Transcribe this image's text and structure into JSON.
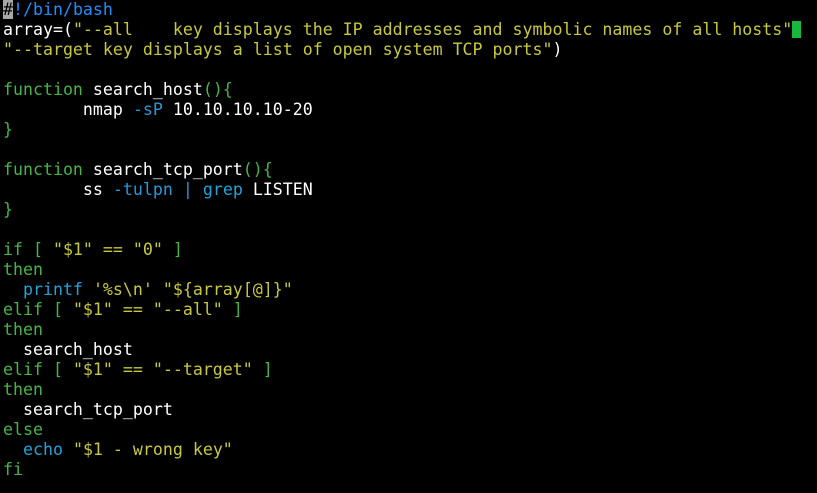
{
  "editor": {
    "language": "bash",
    "colors": {
      "background": "#000000",
      "plain": "#ffffff",
      "comment": "#1e8fff",
      "keyword": "#46b446",
      "string": "#c8c83c",
      "operator": "#2b96d6",
      "command": "#1fa3d9",
      "cursor": "#18b83c"
    },
    "lines": [
      [
        {
          "t": "#",
          "c": "first"
        },
        {
          "t": "!/bin/bash",
          "c": "comment"
        }
      ],
      [
        {
          "t": "array=(",
          "c": "plain"
        },
        {
          "t": "\"--all    key displays the IP addresses and symbolic names of all hosts\"",
          "c": "str"
        },
        {
          "cursor": true
        }
      ],
      [
        {
          "t": "\"--target key displays a list of open system TCP ports\"",
          "c": "str"
        },
        {
          "t": ")",
          "c": "plain"
        }
      ],
      [],
      [
        {
          "t": "function",
          "c": "kw"
        },
        {
          "t": " search_host",
          "c": "plain"
        },
        {
          "t": "(){",
          "c": "kw"
        }
      ],
      [
        {
          "t": "        nmap ",
          "c": "plain"
        },
        {
          "t": "-sP",
          "c": "op"
        },
        {
          "t": " 10.10.10.10-20",
          "c": "plain"
        }
      ],
      [
        {
          "t": "}",
          "c": "kw"
        }
      ],
      [],
      [
        {
          "t": "function",
          "c": "kw"
        },
        {
          "t": " search_tcp_port",
          "c": "plain"
        },
        {
          "t": "(){",
          "c": "kw"
        }
      ],
      [
        {
          "t": "        ss ",
          "c": "plain"
        },
        {
          "t": "-tulpn",
          "c": "op"
        },
        {
          "t": " ",
          "c": "plain"
        },
        {
          "t": "|",
          "c": "op"
        },
        {
          "t": " ",
          "c": "plain"
        },
        {
          "t": "grep",
          "c": "cmd"
        },
        {
          "t": " LISTEN",
          "c": "plain"
        }
      ],
      [
        {
          "t": "}",
          "c": "kw"
        }
      ],
      [],
      [
        {
          "t": "if [ ",
          "c": "kw"
        },
        {
          "t": "\"$1\" == \"0\"",
          "c": "str"
        },
        {
          "t": " ]",
          "c": "kw"
        }
      ],
      [
        {
          "t": "then",
          "c": "kw"
        }
      ],
      [
        {
          "t": "  ",
          "c": "plain"
        },
        {
          "t": "printf",
          "c": "cmd"
        },
        {
          "t": " ",
          "c": "plain"
        },
        {
          "t": "'%s\\n' \"${array[@]}\"",
          "c": "str"
        }
      ],
      [
        {
          "t": "elif [ ",
          "c": "kw"
        },
        {
          "t": "\"$1\" == \"--all\"",
          "c": "str"
        },
        {
          "t": " ]",
          "c": "kw"
        }
      ],
      [
        {
          "t": "then",
          "c": "kw"
        }
      ],
      [
        {
          "t": "  search_host",
          "c": "plain"
        }
      ],
      [
        {
          "t": "elif [ ",
          "c": "kw"
        },
        {
          "t": "\"$1\" == \"--target\"",
          "c": "str"
        },
        {
          "t": " ]",
          "c": "kw"
        }
      ],
      [
        {
          "t": "then",
          "c": "kw"
        }
      ],
      [
        {
          "t": "  search_tcp_port",
          "c": "plain"
        }
      ],
      [
        {
          "t": "else",
          "c": "kw"
        }
      ],
      [
        {
          "t": "  ",
          "c": "plain"
        },
        {
          "t": "echo",
          "c": "cmd"
        },
        {
          "t": " ",
          "c": "plain"
        },
        {
          "t": "\"$1 - wrong key\"",
          "c": "str"
        }
      ],
      [
        {
          "t": "fi",
          "c": "kw"
        }
      ]
    ]
  }
}
